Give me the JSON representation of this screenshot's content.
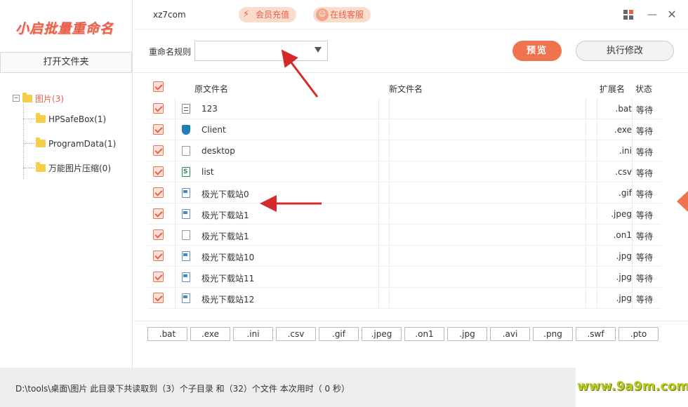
{
  "sidebar": {
    "logo": "小启批量重命名",
    "open_folder_label": "打开文件夹",
    "tree": {
      "toggle": "−",
      "root_label": "图片(3)",
      "children": [
        {
          "label": "HPSafeBox(1)"
        },
        {
          "label": "ProgramData(1)"
        },
        {
          "label": "万能图片压缩(0)"
        }
      ]
    }
  },
  "header": {
    "site_name": "xz7com",
    "vip_label": "会员充值",
    "service_label": "在线客服"
  },
  "toolbar": {
    "rule_label": "重命名规则",
    "rule_value": "",
    "preview_label": "预览",
    "execute_label": "执行修改"
  },
  "table": {
    "headers": {
      "original": "原文件名",
      "new": "新文件名",
      "ext": "扩展名",
      "status": "状态"
    },
    "rows": [
      {
        "name": "123",
        "new": "",
        "ext": ".bat",
        "status": "等待",
        "icon": "bat-file-icon"
      },
      {
        "name": "Client",
        "new": "",
        "ext": ".exe",
        "status": "等待",
        "icon": "exe-file-icon"
      },
      {
        "name": "desktop",
        "new": "",
        "ext": ".ini",
        "status": "等待",
        "icon": "ini-file-icon"
      },
      {
        "name": "list",
        "new": "",
        "ext": ".csv",
        "status": "等待",
        "icon": "csv-file-icon"
      },
      {
        "name": "极光下载站0",
        "new": "",
        "ext": ".gif",
        "status": "等待",
        "icon": "image-file-icon"
      },
      {
        "name": "极光下载站1",
        "new": "",
        "ext": ".jpeg",
        "status": "等待",
        "icon": "image-file-icon"
      },
      {
        "name": "极光下载站1",
        "new": "",
        "ext": ".on1",
        "status": "等待",
        "icon": "blank-file-icon"
      },
      {
        "name": "极光下载站10",
        "new": "",
        "ext": ".jpg",
        "status": "等待",
        "icon": "image-file-icon"
      },
      {
        "name": "极光下载站11",
        "new": "",
        "ext": ".jpg",
        "status": "等待",
        "icon": "image-file-icon"
      },
      {
        "name": "极光下载站12",
        "new": "",
        "ext": ".jpg",
        "status": "等待",
        "icon": "image-file-icon"
      }
    ]
  },
  "ext_filters": [
    ".bat",
    ".exe",
    ".ini",
    ".csv",
    ".gif",
    ".jpeg",
    ".on1",
    ".jpg",
    ".avi",
    ".png",
    ".swf",
    ".pto"
  ],
  "statusbar": {
    "text": "D:\\tools\\桌面\\图片 此目录下共读取到（3）个子目录 和（32）个文件 本次用时（ 0 秒）"
  },
  "watermark": "www.9a9m.com",
  "colors": {
    "accent": "#f0734f",
    "logo": "#e8604a",
    "statusbar_bg": "#ecedef",
    "watermark": "#b8c926",
    "arrow": "#d42a2a"
  }
}
